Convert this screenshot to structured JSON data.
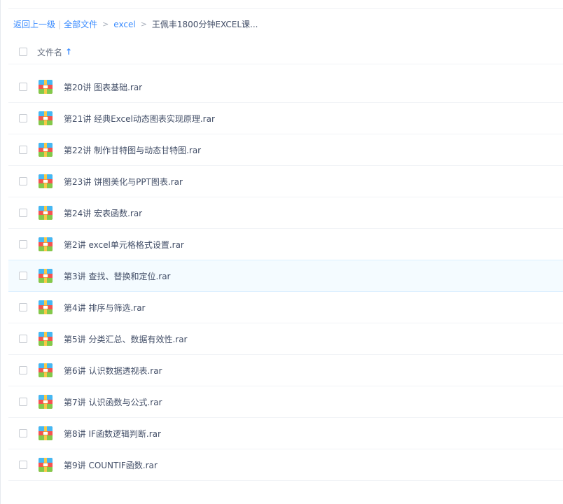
{
  "breadcrumb": {
    "back": "返回上一级",
    "separator": "|",
    "all_files": "全部文件",
    "arrow": ">",
    "folder": "excel",
    "current": "王佩丰1800分钟EXCEL课..."
  },
  "header": {
    "column_name": "文件名",
    "sort_icon": "↑"
  },
  "files": [
    {
      "name": "第20讲 图表基础.rar"
    },
    {
      "name": "第21讲 经典Excel动态图表实现原理.rar"
    },
    {
      "name": "第22讲 制作甘特图与动态甘特图.rar"
    },
    {
      "name": "第23讲 饼图美化与PPT图表.rar"
    },
    {
      "name": "第24讲 宏表函数.rar"
    },
    {
      "name": "第2讲 excel单元格格式设置.rar"
    },
    {
      "name": "第3讲 查找、替换和定位.rar"
    },
    {
      "name": "第4讲 排序与筛选.rar"
    },
    {
      "name": "第5讲 分类汇总、数据有效性.rar"
    },
    {
      "name": "第6讲 认识数据透视表.rar"
    },
    {
      "name": "第7讲 认识函数与公式.rar"
    },
    {
      "name": "第8讲 IF函数逻辑判断.rar"
    },
    {
      "name": "第9讲 COUNTIF函数.rar"
    }
  ],
  "icons": {
    "file_icon": "rar-archive-icon"
  },
  "colors": {
    "link": "#3b8cff",
    "hover_row": "#f4fbff"
  }
}
